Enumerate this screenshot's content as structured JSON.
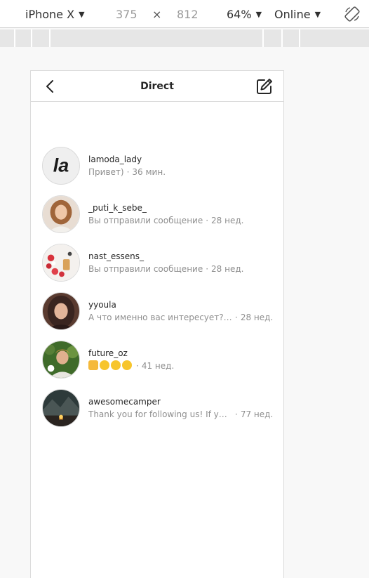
{
  "devtools": {
    "device": "iPhone X",
    "width": "375",
    "times": "×",
    "height": "812",
    "zoom": "64%",
    "network": "Online"
  },
  "header": {
    "title": "Direct"
  },
  "threads": [
    {
      "username": "lamoda_lady",
      "message": "Привет)",
      "time": "36 мин.",
      "avatar_text": "la"
    },
    {
      "username": "_puti_k_sebe_",
      "message": "Вы отправили сообщение",
      "time": "28 нед."
    },
    {
      "username": "nast_essens_",
      "message": "Вы отправили сообщение",
      "time": "28 нед."
    },
    {
      "username": "yyoula",
      "message": "А что именно вас интересует? Я…",
      "time": "28 нед."
    },
    {
      "username": "future_oz",
      "message": "",
      "time": "41 нед.",
      "emoji": [
        "thumbs-up",
        "laughing",
        "laughing",
        "laughing"
      ]
    },
    {
      "username": "awesomecamper",
      "message": "Thank you for following us! If you…",
      "time": "77 нед."
    }
  ],
  "separator": "·"
}
